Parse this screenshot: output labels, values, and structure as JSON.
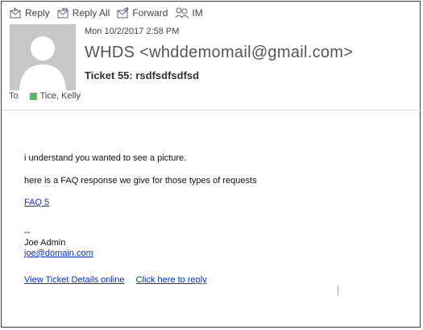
{
  "toolbar": {
    "reply": "Reply",
    "reply_all": "Reply All",
    "forward": "Forward",
    "im": "IM"
  },
  "header": {
    "date": "Mon 10/2/2017 2:58 PM",
    "sender": "WHDS <whddemomail@gmail.com>",
    "subject": "Ticket 55: rsdfsdfsdfsd",
    "to_label": "To",
    "recipient": "Tice, Kelly",
    "presence_color": "#5cb85c"
  },
  "message": {
    "line1": "i understand you wanted to see a picture.",
    "line2": "here is a FAQ response we give for those types of requests",
    "faq_link": "FAQ 5",
    "sig_dashes": "--",
    "sig_name": "Joe Admin",
    "sig_email": "joe@domain.com",
    "link_ticket": "View Ticket Details online",
    "link_reply": "Click here to reply"
  },
  "icons": [
    "reply-icon",
    "reply-all-icon",
    "forward-icon",
    "im-icon",
    "avatar-placeholder"
  ]
}
